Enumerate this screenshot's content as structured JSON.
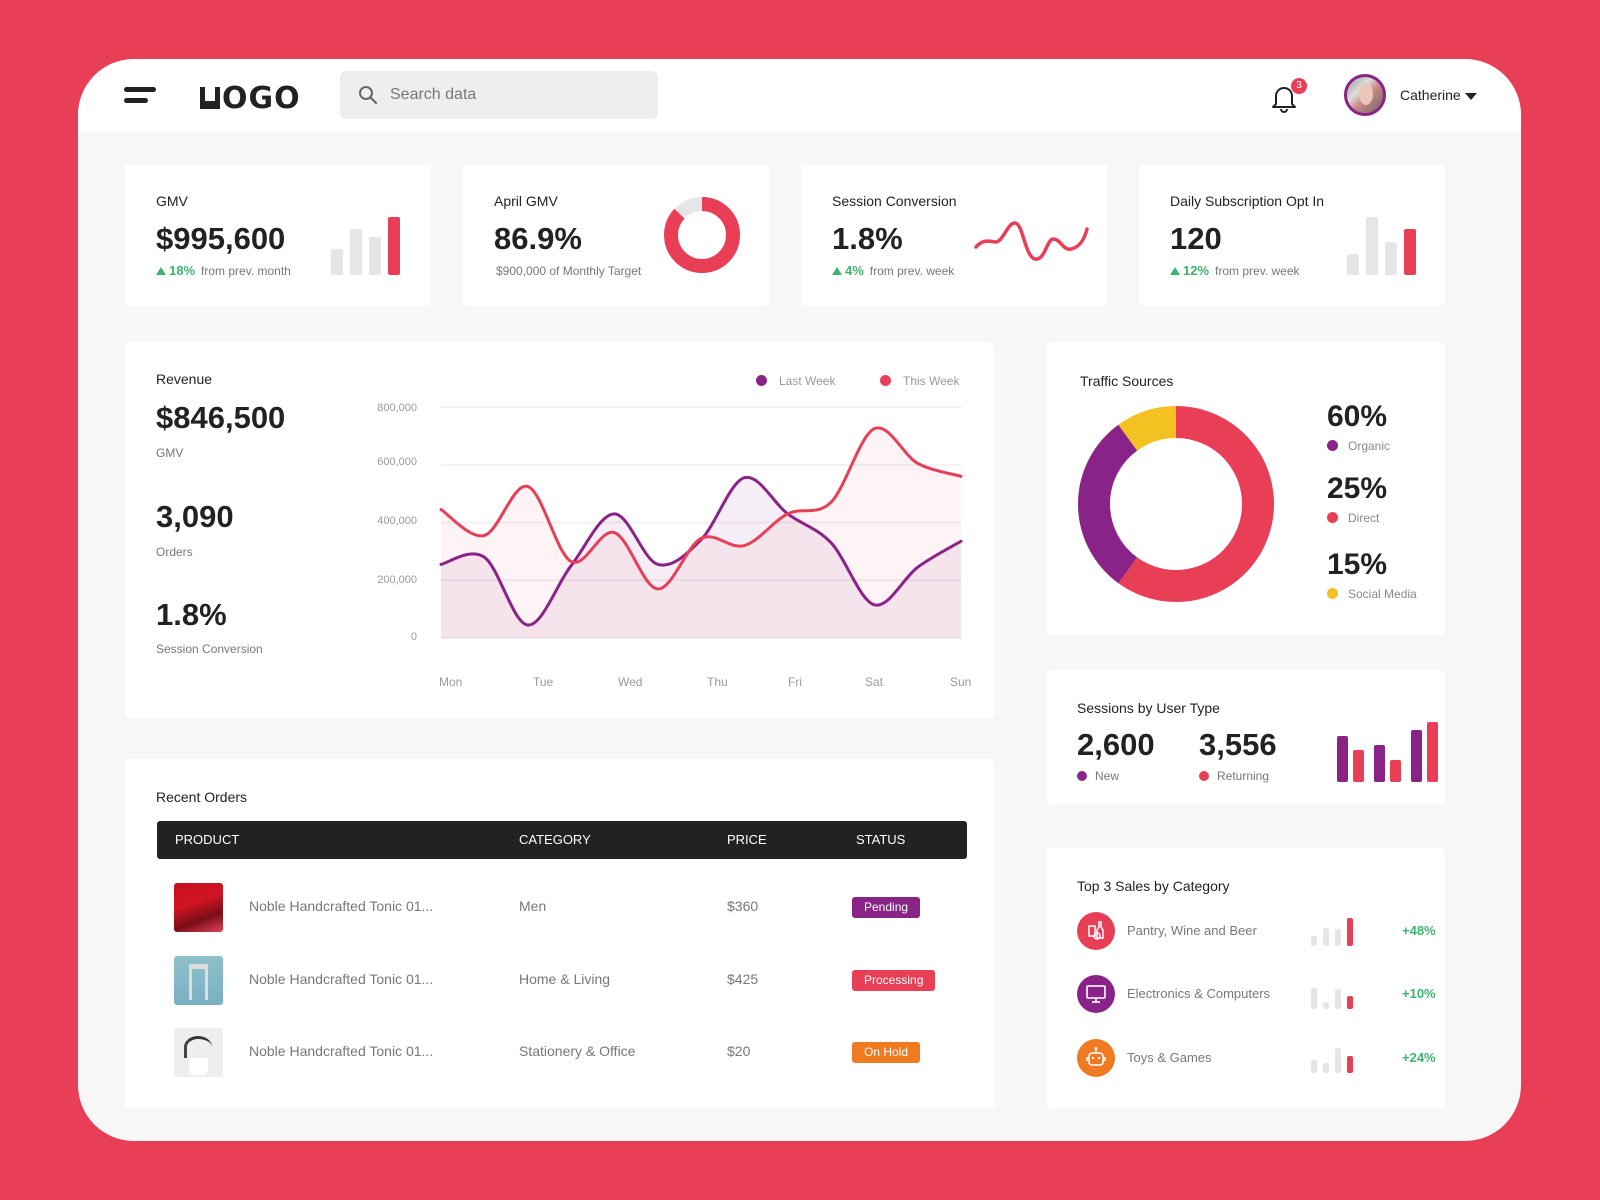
{
  "header": {
    "logo": "OGO",
    "search_placeholder": "Search data",
    "notifications_count": "3",
    "user_name": "Catherine"
  },
  "colors": {
    "brand": "#E83F57",
    "purple": "#8A2387",
    "yellow": "#F3C121",
    "orange": "#F07A22",
    "positive": "#3DB46D",
    "table_header": "#222222"
  },
  "kpis": [
    {
      "title": "GMV",
      "value": "$995,600",
      "delta": "18%",
      "delta_text": "from prev. month",
      "bars": [
        0.45,
        0.8,
        0.65,
        1.0
      ]
    },
    {
      "title": "April GMV",
      "value": "86.9%",
      "sub": "$900,000 of Monthly Target",
      "progress": 0.869
    },
    {
      "title": "Session Conversion",
      "value": "1.8%",
      "delta": "4%",
      "delta_text": "from prev. week"
    },
    {
      "title": "Daily Subscription Opt In",
      "value": "120",
      "delta": "12%",
      "delta_text": "from prev. week",
      "bars": [
        0.37,
        1.0,
        0.57,
        0.8
      ]
    }
  ],
  "revenue": {
    "title": "Revenue",
    "stats": [
      {
        "value": "$846,500",
        "label": "GMV"
      },
      {
        "value": "3,090",
        "label": "Orders"
      },
      {
        "value": "1.8%",
        "label": "Session Conversion"
      }
    ]
  },
  "chart_data": {
    "type": "area",
    "title": "Revenue",
    "categories": [
      "Mon",
      "Tue",
      "Wed",
      "Thu",
      "Fri",
      "Sat",
      "Sun"
    ],
    "yticks": [
      "0",
      "200,000",
      "400,000",
      "600,000",
      "800,000"
    ],
    "ylim": [
      0,
      800000
    ],
    "legend": "top-right",
    "grid": true,
    "x": [
      0,
      0.5,
      1,
      1.5,
      2,
      2.5,
      3,
      3.5,
      4,
      4.5,
      5,
      5.5,
      6
    ],
    "series": [
      {
        "name": "Last Week",
        "color": "#8A2387",
        "values": [
          255000,
          280000,
          45000,
          250000,
          430000,
          255000,
          340000,
          555000,
          430000,
          330000,
          115000,
          245000,
          335000
        ]
      },
      {
        "name": "This Week",
        "color": "#E83F57",
        "values": [
          445000,
          355000,
          525000,
          265000,
          365000,
          170000,
          345000,
          320000,
          430000,
          470000,
          725000,
          605000,
          560000
        ]
      }
    ]
  },
  "traffic": {
    "title": "Traffic Sources",
    "items": [
      {
        "pct": "60%",
        "label": "Organic",
        "color": "#8A2387"
      },
      {
        "pct": "25%",
        "label": "Direct",
        "color": "#E83F57"
      },
      {
        "pct": "15%",
        "label": "Social Media",
        "color": "#F3C121"
      }
    ],
    "donut": [
      {
        "label": "Direct",
        "fraction": 0.6,
        "color": "#E83F57"
      },
      {
        "label": "Organic",
        "fraction": 0.3,
        "color": "#8A2387"
      },
      {
        "label": "Social Media",
        "fraction": 0.1,
        "color": "#F3C121"
      }
    ]
  },
  "sessions": {
    "title": "Sessions by User Type",
    "new_value": "2,600",
    "new_label": "New",
    "returning_value": "3,556",
    "returning_label": "Returning",
    "bars": [
      {
        "new": 0.76,
        "returning": 0.54
      },
      {
        "new": 0.61,
        "returning": 0.37
      },
      {
        "new": 0.86,
        "returning": 1.0
      }
    ]
  },
  "orders": {
    "title": "Recent Orders",
    "columns": [
      "PRODUCT",
      "CATEGORY",
      "PRICE",
      "STATUS"
    ],
    "rows": [
      {
        "product": "Noble Handcrafted Tonic 01...",
        "category": "Men",
        "price": "$360",
        "status": "Pending",
        "status_color": "#8A2387",
        "thumb": "sneaker"
      },
      {
        "product": "Noble Handcrafted Tonic 01...",
        "category": "Home & Living",
        "price": "$425",
        "status": "Processing",
        "status_color": "#E83F57",
        "thumb": "stool"
      },
      {
        "product": "Noble Handcrafted Tonic 01...",
        "category": "Stationery & Office",
        "price": "$20",
        "status": "On Hold",
        "status_color": "#F07A22",
        "thumb": "plant"
      }
    ]
  },
  "top_sales": {
    "title": "Top 3 Sales by Category",
    "items": [
      {
        "name": "Pantry, Wine and Beer",
        "pct": "+48%",
        "icon": "wine-bottle-icon",
        "color": "#E83F57",
        "bars": [
          0.35,
          0.65,
          0.6,
          1.0
        ]
      },
      {
        "name": "Electronics & Computers",
        "pct": "+10%",
        "icon": "monitor-icon",
        "color": "#8A2387",
        "bars": [
          0.75,
          0.25,
          0.7,
          0.45
        ]
      },
      {
        "name": "Toys & Games",
        "pct": "+24%",
        "icon": "robot-icon",
        "color": "#F07A22",
        "bars": [
          0.45,
          0.35,
          0.9,
          0.6
        ]
      }
    ]
  }
}
